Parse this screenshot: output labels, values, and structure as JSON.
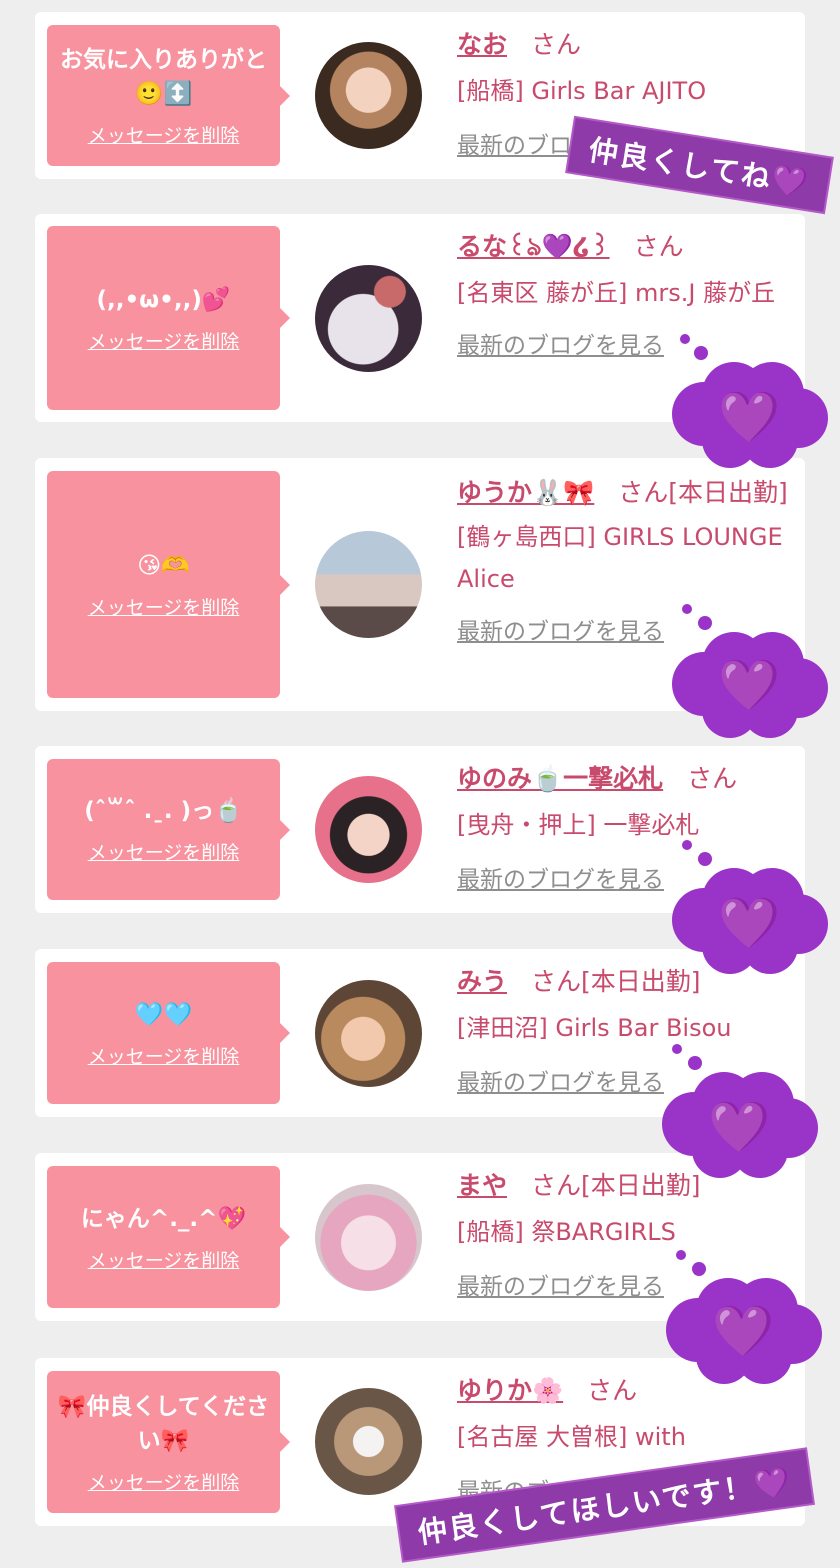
{
  "delete_label": "メッセージを削除",
  "blog_label": "最新のブログを見る",
  "san_label": "さん",
  "cards": [
    {
      "message": "お気に入りありがと🙂↕️",
      "name": "なお",
      "status": "",
      "shop": "[船橋] Girls Bar AJITO"
    },
    {
      "message": "(,,•ω•,,)💕",
      "name": "るな꒰ঌ💜໒꒱",
      "status": "",
      "shop": "[名東区 藤が丘] mrs.J 藤が丘"
    },
    {
      "message": "😘🫶",
      "name": "ゆうか🐰🎀",
      "status": "[本日出勤]",
      "shop": "[鶴ヶ島西口] GIRLS LOUNGE Alice"
    },
    {
      "message": "(ˆ꒳ˆ .ˍ. )っ🍵",
      "name": "ゆのみ🍵一撃必札",
      "status": "",
      "shop": "[曳舟・押上] 一撃必札"
    },
    {
      "message": "🩵🩵",
      "name": "みう",
      "status": "[本日出勤]",
      "shop": "[津田沼] Girls Bar Bisou"
    },
    {
      "message": "にゃん^._.^💖",
      "name": "まや",
      "status": "[本日出勤]",
      "shop": "[船橋] 祭BARGIRLS"
    },
    {
      "message": "🎀仲良くしてください🎀",
      "name": "ゆりか🌸",
      "status": "",
      "shop": "[名古屋 大曽根] with"
    }
  ],
  "overlays": {
    "banner_top": "仲良くしてね💜",
    "banner_bottom": "仲良くしてほしいです！💜",
    "heart": "💜"
  },
  "colors": {
    "page_bg": "#eeeeee",
    "card_bg": "#ffffff",
    "bubble": "#f7929e",
    "name_text": "#c84a6c",
    "link_gray": "#8e8e8e",
    "sticker_purple": "#9a33c8",
    "banner_purple": "#8e3aa8"
  }
}
